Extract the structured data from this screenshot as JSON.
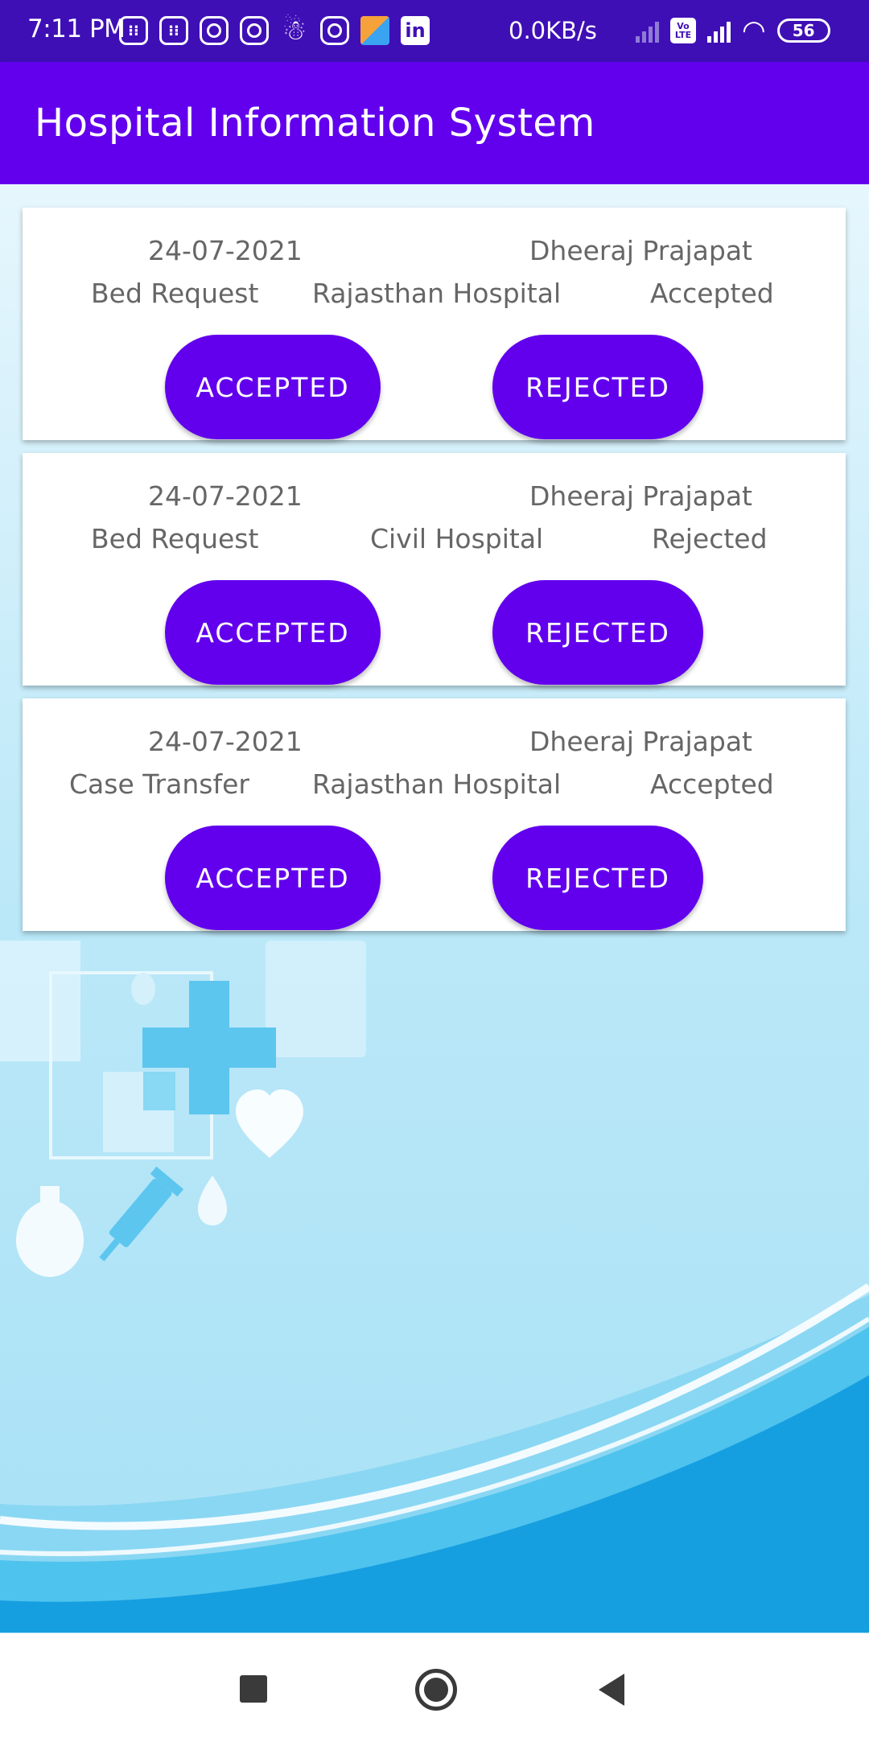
{
  "status_bar": {
    "time": "7:11 PM",
    "network_speed": "0.0KB/s",
    "volte": "Vo LTE",
    "net_type": "4G",
    "battery": "56"
  },
  "app_bar": {
    "title": "Hospital Information System"
  },
  "requests": [
    {
      "date": "24-07-2021",
      "name": "Dheeraj Prajapat",
      "type": "Bed Request",
      "hospital": "Rajasthan Hospital",
      "status": "Accepted",
      "accept_label": "ACCEPTED",
      "reject_label": "REJECTED"
    },
    {
      "date": "24-07-2021",
      "name": "Dheeraj Prajapat",
      "type": "Bed Request",
      "hospital": "Civil Hospital",
      "status": "Rejected",
      "accept_label": "ACCEPTED",
      "reject_label": "REJECTED"
    },
    {
      "date": "24-07-2021",
      "name": "Dheeraj Prajapat",
      "type": "Case Transfer",
      "hospital": "Rajasthan Hospital",
      "status": "Accepted",
      "accept_label": "ACCEPTED",
      "reject_label": "REJECTED"
    }
  ],
  "icons": [
    "calculator-icon",
    "instagram-icon",
    "snapchat-icon",
    "linkedin-icon",
    "wifi-icon",
    "battery-icon",
    "nav-recents-icon",
    "nav-home-icon",
    "nav-back-icon"
  ],
  "colors": {
    "primary": "#6200ee",
    "status_bar": "#3f0fb6",
    "text": "#666666"
  }
}
